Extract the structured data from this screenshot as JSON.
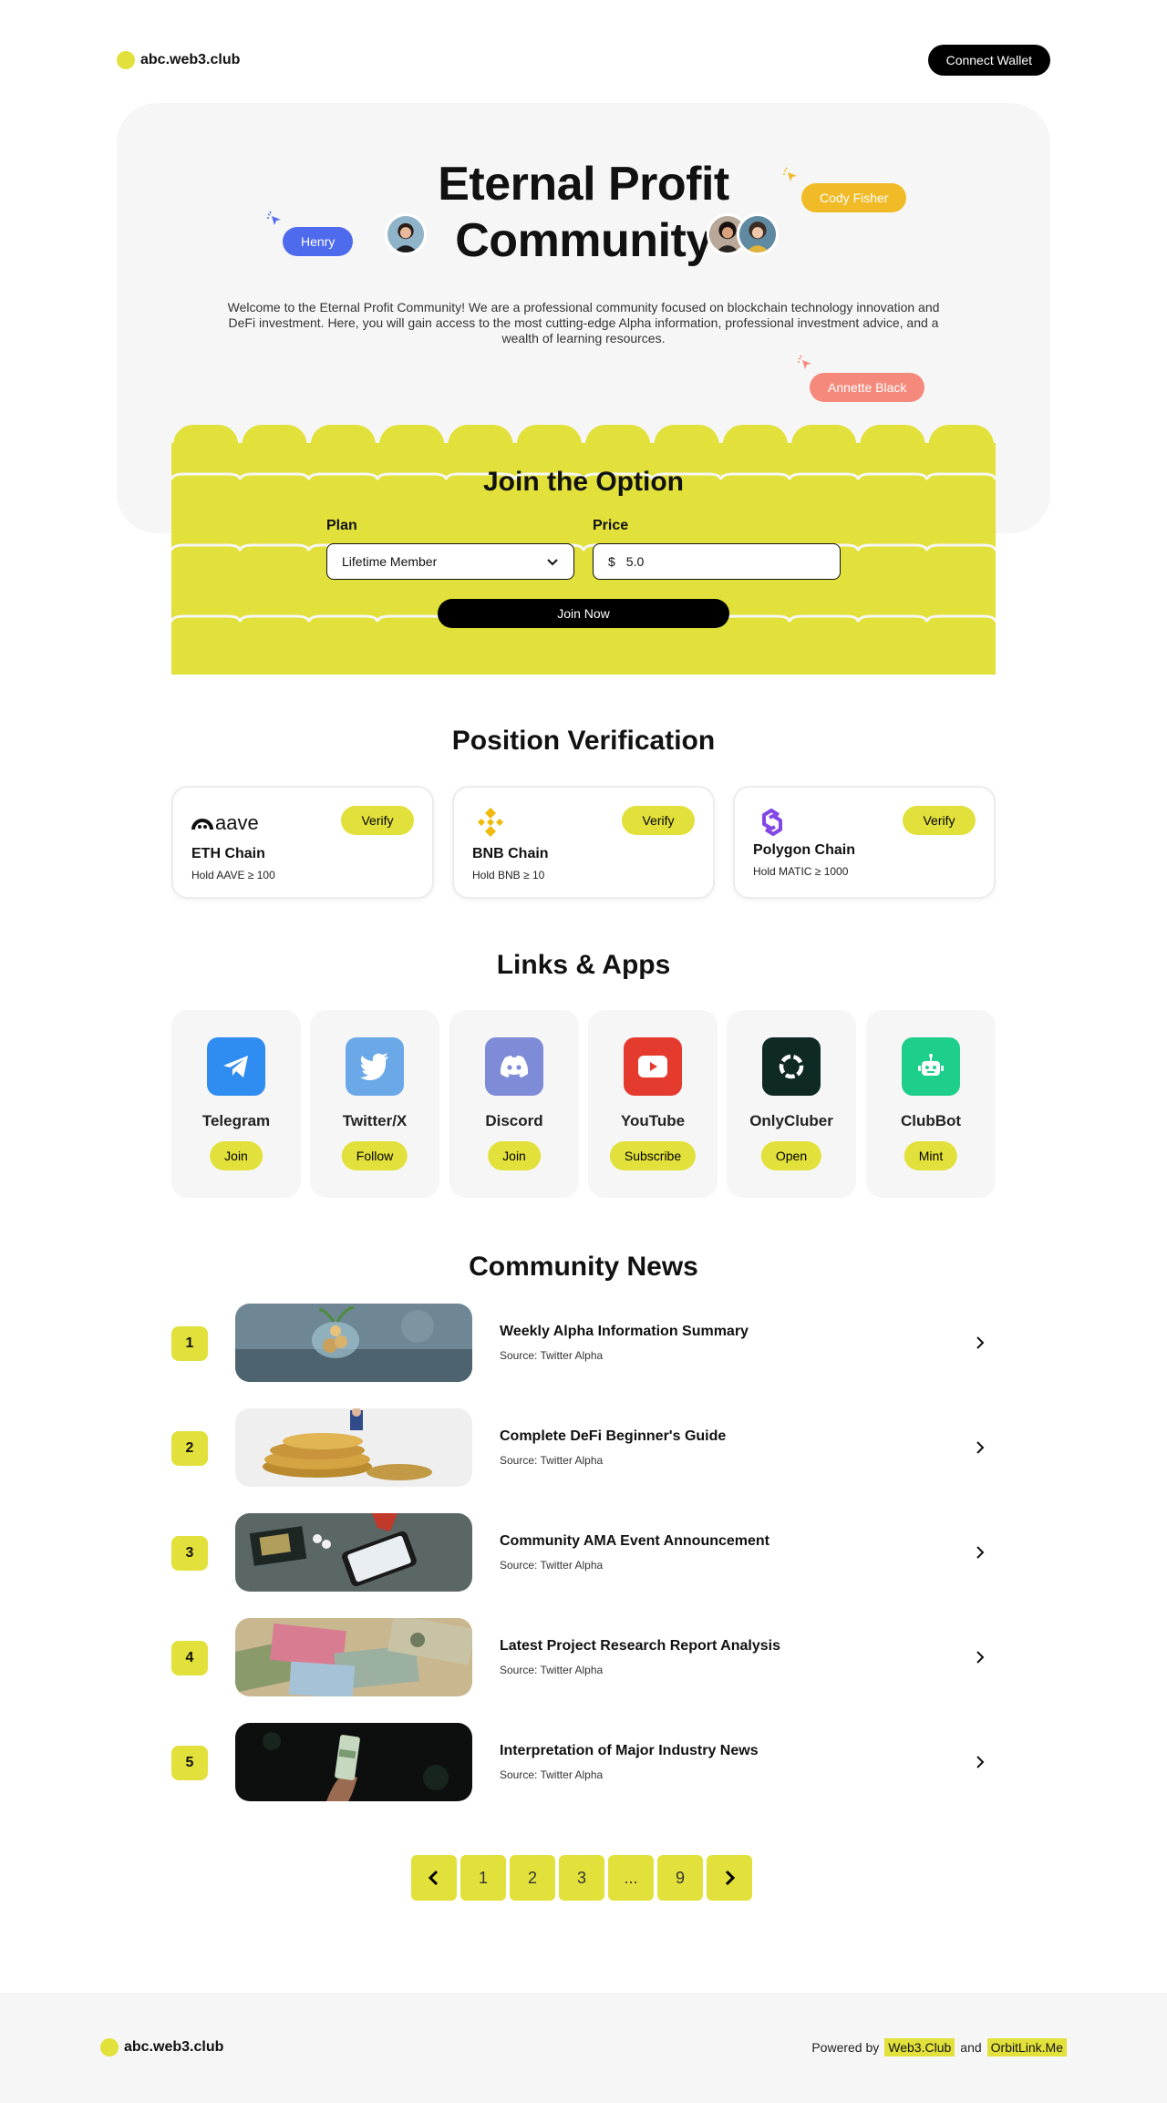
{
  "header": {
    "brand": "abc.web3.club",
    "connect_label": "Connect Wallet"
  },
  "hero": {
    "title_line1": "Eternal Profit",
    "title_line2": "Community",
    "description": "Welcome to the Eternal Profit Community! We are a professional community focused on blockchain technology innovation and DeFi investment. Here, you will gain access to the most cutting-edge Alpha information, professional investment advice, and a wealth of learning resources.",
    "tags": [
      {
        "name": "Henry",
        "color": "#4f6bed"
      },
      {
        "name": "Cody Fisher",
        "color": "#f0bb26"
      },
      {
        "name": "Annette Black",
        "color": "#f58a7c"
      }
    ]
  },
  "join": {
    "title": "Join the Option",
    "plan_label": "Plan",
    "plan_value": "Lifetime Member",
    "price_label": "Price",
    "currency": "$",
    "price_value": "5.0",
    "button": "Join Now",
    "accent": "#e2e13b"
  },
  "verification": {
    "title": "Position Verification",
    "button": "Verify",
    "cards": [
      {
        "logo_text": "aave",
        "name": "ETH Chain",
        "condition": "Hold AAVE ≥ 100"
      },
      {
        "name": "BNB Chain",
        "condition": "Hold BNB ≥ 10"
      },
      {
        "name": "Polygon Chain",
        "condition": "Hold MATIC ≥ 1000"
      }
    ]
  },
  "links": {
    "title": "Links & Apps",
    "apps": [
      {
        "name": "Telegram",
        "action": "Join",
        "icon": "telegram-icon",
        "color": "#2f8cf0"
      },
      {
        "name": "Twitter/X",
        "action": "Follow",
        "icon": "twitter-icon",
        "color": "#6aa8e8"
      },
      {
        "name": "Discord",
        "action": "Join",
        "icon": "discord-icon",
        "color": "#7e8bd6"
      },
      {
        "name": "YouTube",
        "action": "Subscribe",
        "icon": "youtube-icon",
        "color": "#e53a2e"
      },
      {
        "name": "OnlyCluber",
        "action": "Open",
        "icon": "onlycluber-icon",
        "color": "#0f2a24"
      },
      {
        "name": "ClubBot",
        "action": "Mint",
        "icon": "robot-icon",
        "color": "#1dcf8b"
      }
    ]
  },
  "news": {
    "title": "Community News",
    "items": [
      {
        "num": "1",
        "title": "Weekly Alpha Information Summary",
        "source": "Source: Twitter Alpha"
      },
      {
        "num": "2",
        "title": "Complete DeFi Beginner's Guide",
        "source": "Source: Twitter Alpha"
      },
      {
        "num": "3",
        "title": "Community AMA Event Announcement",
        "source": "Source: Twitter Alpha"
      },
      {
        "num": "4",
        "title": "Latest Project Research Report Analysis",
        "source": "Source: Twitter Alpha"
      },
      {
        "num": "5",
        "title": "Interpretation of Major Industry News",
        "source": "Source: Twitter Alpha"
      }
    ]
  },
  "pagination": {
    "pages": [
      "1",
      "2",
      "3",
      "...",
      "9"
    ]
  },
  "footer": {
    "brand": "abc.web3.club",
    "powered_by": "Powered by",
    "link1": "Web3.Club",
    "and": "and",
    "link2": "OrbitLink.Me"
  }
}
